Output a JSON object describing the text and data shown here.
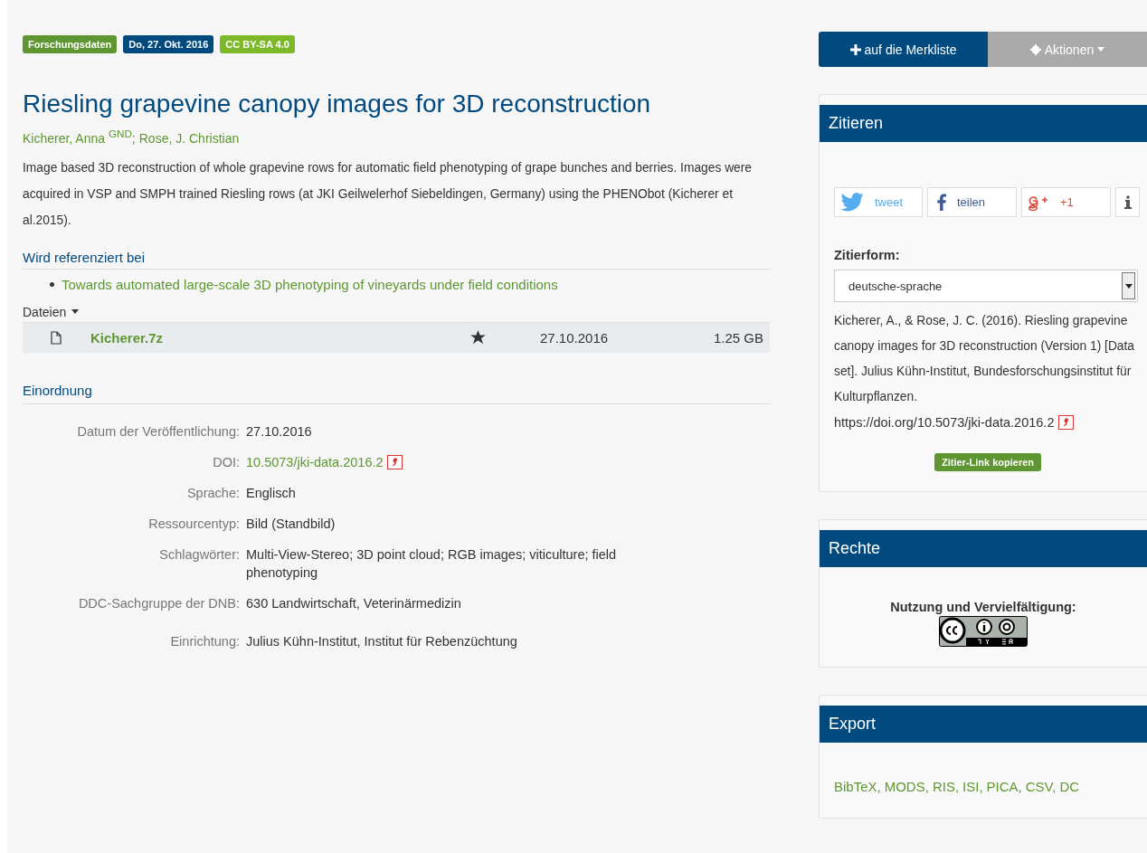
{
  "badges": [
    {
      "label": "Forschungsdaten",
      "color": "#5e9732"
    },
    {
      "label": "Do, 27. Okt. 2016",
      "color": "#004a80"
    },
    {
      "label": "CC BY-SA 4.0",
      "color": "#7cb827"
    }
  ],
  "title": "Riesling grapevine canopy images for 3D reconstruction",
  "authors": {
    "items": [
      "Kicherer, Anna $^{GND}$",
      "Rose, J. Christian"
    ],
    "separator": ";"
  },
  "abstract": "Image based 3D reconstruction of whole grapevine rows for automatic field phenotyping of grape bunches and berries. Images were acquired in VSP and SMPH trained Riesling rows (at JKI Geilwelerhof Siebeldingen, Germany) using the PHENObot (Kicherer et al.2015).",
  "referenced": {
    "heading": "Wird referenziert bei",
    "items": [
      "Towards automated large-scale 3D phenotyping of vineyards under field conditions"
    ]
  },
  "files": {
    "label": "Dateien",
    "rows": [
      {
        "name": "Kicherer.7z",
        "date": "27.10.2016",
        "size": "1.25 GB"
      }
    ]
  },
  "classification": {
    "heading": "Einordnung",
    "rows": [
      {
        "label": "Datum der Veröffentlichung:",
        "value": "27.10.2016",
        "kind": "text"
      },
      {
        "label": "DOI:",
        "value": "10.5073/jki-data.2016.2",
        "kind": "link"
      },
      {
        "label": "Sprache:",
        "value": "Englisch",
        "kind": "text"
      },
      {
        "label": "Ressourcentyp:",
        "value": "Bild (Standbild)",
        "kind": "text"
      },
      {
        "label": "Schlagwörter:",
        "value": "Multi-View-Stereo; 3D point cloud; RGB images; viticulture; field phenotyping",
        "kind": "text"
      },
      {
        "label": "DDC-Sachgruppe der DNB:",
        "value": "630 Landwirtschaft, Veterinärmedizin",
        "kind": "text"
      },
      {
        "label": "Einrichtung:",
        "value": "Julius Kühn-Institut, Institut für Rebenzüchtung",
        "kind": "gap"
      }
    ]
  },
  "actions": {
    "bookmark": "auf die Merkliste",
    "menu": "Aktionen"
  },
  "cite": {
    "heading": "Zitieren",
    "share": [
      {
        "kind": "twitter",
        "label": "tweet"
      },
      {
        "kind": "facebook",
        "label": "teilen"
      },
      {
        "kind": "google",
        "label": "+1"
      },
      {
        "kind": "info"
      }
    ],
    "style_label": "Zitierform:",
    "style_value": "deutsche-sprache",
    "text": "Kicherer, A., & Rose, J. C. (2016). Riesling grapevine canopy images for 3D reconstruction (Version 1) [Data set]. Julius Kühn-Institut, Bundesforschungsinstitut für Kulturpflanzen.",
    "doi": "https://doi.org/10.5073/jki-data.2016.2",
    "copy_button": "Zitier-Link kopieren"
  },
  "rights": {
    "heading": "Rechte",
    "label": "Nutzung und Vervielfältigung:"
  },
  "export": {
    "heading": "Export",
    "separator": ",",
    "formats": [
      "BibTeX",
      "MODS",
      "RIS",
      "ISI",
      "PICA",
      "CSV",
      "DC"
    ]
  }
}
